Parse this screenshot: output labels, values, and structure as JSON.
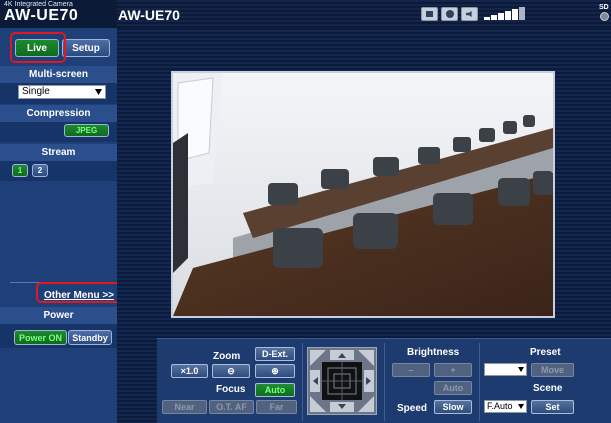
{
  "brand": {
    "subtitle": "4K Integrated Camera",
    "model": "AW-UE70"
  },
  "topbar": {
    "title": "AW-UE70",
    "icons": [
      "screen-icon",
      "camera-icon",
      "volume-icon"
    ],
    "signal_bars": 5,
    "sd_label": "SD"
  },
  "sidebar": {
    "live_label": "Live",
    "setup_label": "Setup",
    "multiscreen": {
      "heading": "Multi-screen",
      "selected": "Single"
    },
    "compression": {
      "heading": "Compression",
      "format": "JPEG"
    },
    "stream": {
      "heading": "Stream",
      "options": [
        "1",
        "2"
      ]
    },
    "other_menu": "Other Menu >>",
    "power": {
      "heading": "Power",
      "on_label": "Power ON",
      "standby_label": "Standby"
    }
  },
  "controls": {
    "zoom": {
      "label": "Zoom",
      "dext": "D-Ext.",
      "ratio": "×1.0"
    },
    "focus": {
      "label": "Focus",
      "auto": "Auto",
      "near": "Near",
      "otaf": "O.T. AF",
      "far": "Far"
    },
    "brightness": {
      "label": "Brightness",
      "minus": "–",
      "plus": "+",
      "auto": "Auto"
    },
    "speed": {
      "label": "Speed",
      "value": "Slow"
    },
    "preset": {
      "label": "Preset",
      "selected": "",
      "move": "Move"
    },
    "scene": {
      "label": "Scene",
      "selected": "F.Auto",
      "set": "Set"
    }
  },
  "colors": {
    "highlight": "#e01820",
    "active_green": "#1c8a2f",
    "panel": "#1f3f79"
  }
}
